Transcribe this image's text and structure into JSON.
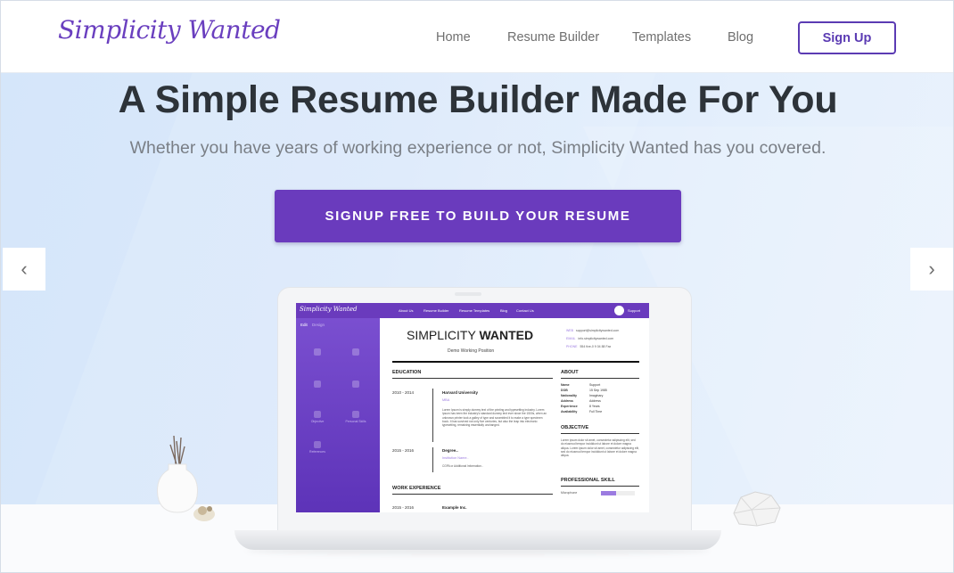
{
  "header": {
    "logo": "Simplicity Wanted",
    "nav": [
      "Home",
      "Resume Builder",
      "Templates",
      "Blog"
    ],
    "signup_label": "Sign Up"
  },
  "hero": {
    "title": "A Simple Resume Builder Made For You",
    "subtitle": "Whether you have years of working experience or not, Simplicity Wanted has you covered.",
    "cta_label": "SIGNUP FREE TO BUILD YOUR RESUME",
    "prev_arrow": "‹",
    "next_arrow": "›"
  },
  "preview": {
    "logo": "Simplicity Wanted",
    "nav": [
      "About Us",
      "Resume Builder",
      "Resume Templates",
      "Blog",
      "Contact Us"
    ],
    "support": "Support",
    "side_tabs": [
      "Edit",
      "Design"
    ],
    "side_items": [
      "Objective",
      "Personal Skills",
      "References"
    ],
    "name_first": "SIMPLICITY ",
    "name_last": "WANTED",
    "role": "Demo Working Position",
    "contact": [
      {
        "k": "WEB",
        "v": "support@simplicitywanted.com"
      },
      {
        "k": "EMAIL",
        "v": "info.simplicitywanted.com"
      },
      {
        "k": "PHONE",
        "v": "554 five-0 9 04 88 Fax"
      }
    ],
    "education_heading": "EDUCATION",
    "edu1_years": "2010 - 2014",
    "edu1_school": "Harvard University",
    "edu1_degree": "MBA",
    "edu1_text": "Lorem Ipsum is simply dummy text of the printing and typesetting industry. Lorem Ipsum has been the industry's standard dummy text ever since the 1500s, when an unknown printer took a galley of type and scrambled it to make a type specimen book. It has survived not only five centuries, but also the leap into electronic typesetting, remaining essentially unchanged.",
    "edu2_years": "2015 - 2016",
    "edu2_school": "Degree..",
    "edu2_degree": "Institution Name..",
    "edu2_text": "CGPA or Additional Information..",
    "work_heading": "WORK EXPERIENCE",
    "work1_years": "2015 - 2016",
    "work1_company": "Example Inc.",
    "about_heading": "ABOUT",
    "about": [
      {
        "k": "Name",
        "v": "Support"
      },
      {
        "k": "DOB",
        "v": "15 Sep 1985"
      },
      {
        "k": "Nationality",
        "v": "Imaginary"
      },
      {
        "k": "Address",
        "v": "Address"
      },
      {
        "k": "Experience",
        "v": "8 Years"
      },
      {
        "k": "Availability",
        "v": "Full Time"
      }
    ],
    "objective_heading": "OBJECTIVE",
    "objective_text": "Lorem ipsum dolor sit amet, consectetur adipiscing elit, sed do eiusmod tempor incididunt ut labore et dolore magna aliqua. Lorem ipsum dolor sit amet, consectetur adipiscing elit, sed do eiusmod tempor incididunt ut labore et dolore magna aliqua.",
    "skill_heading": "PROFESSIONAL SKILL",
    "skill_name": "Microphone",
    "skill_level": 0.45
  },
  "colors": {
    "brand": "#6a3bbd",
    "text": "#2d3339",
    "muted": "#7a7f86",
    "nav": "#6f6f6f"
  }
}
